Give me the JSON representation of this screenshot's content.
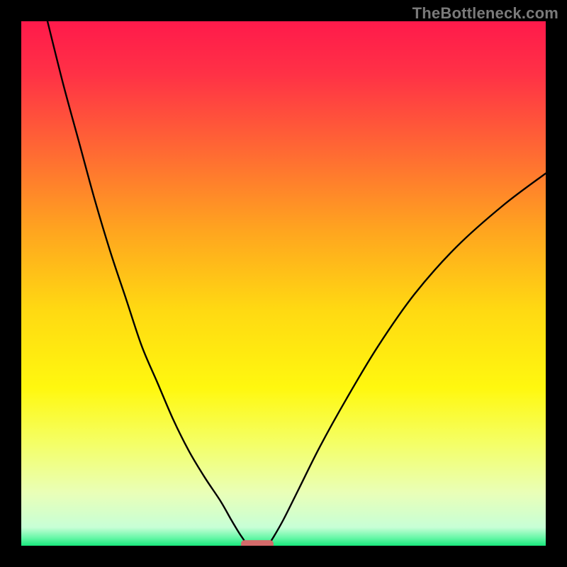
{
  "watermark": "TheBottleneck.com",
  "chart_data": {
    "type": "line",
    "title": "",
    "xlabel": "",
    "ylabel": "",
    "xlim": [
      0,
      100
    ],
    "ylim": [
      0,
      100
    ],
    "grid": false,
    "legend": false,
    "annotations": [],
    "background_gradient_stops": [
      {
        "offset": 0.0,
        "color": "#ff1a4b"
      },
      {
        "offset": 0.1,
        "color": "#ff3146"
      },
      {
        "offset": 0.25,
        "color": "#ff6a33"
      },
      {
        "offset": 0.4,
        "color": "#ffa51f"
      },
      {
        "offset": 0.55,
        "color": "#ffd912"
      },
      {
        "offset": 0.7,
        "color": "#fff80f"
      },
      {
        "offset": 0.8,
        "color": "#f5ff62"
      },
      {
        "offset": 0.9,
        "color": "#e9ffb8"
      },
      {
        "offset": 0.965,
        "color": "#c7ffd6"
      },
      {
        "offset": 0.985,
        "color": "#66f7a7"
      },
      {
        "offset": 1.0,
        "color": "#18e87c"
      }
    ],
    "series": [
      {
        "name": "left-branch",
        "x": [
          5,
          8,
          11,
          14,
          17,
          20,
          23,
          26,
          29,
          32,
          35,
          38,
          40,
          41.5,
          42.5,
          43
        ],
        "y": [
          100,
          88,
          77,
          66,
          56,
          47,
          38,
          31,
          24,
          18,
          13,
          8.5,
          5,
          2.5,
          1,
          0
        ]
      },
      {
        "name": "right-branch",
        "x": [
          47,
          48,
          50,
          53,
          57,
          62,
          68,
          75,
          83,
          92,
          100
        ],
        "y": [
          0,
          1.5,
          5,
          11,
          19,
          28,
          38,
          48,
          57,
          65,
          71
        ]
      }
    ],
    "marker": {
      "shape": "rounded-rect",
      "x": 45,
      "y": 0,
      "width_pct": 6.2,
      "height_pct": 1.6,
      "color": "#d46a6a"
    }
  }
}
